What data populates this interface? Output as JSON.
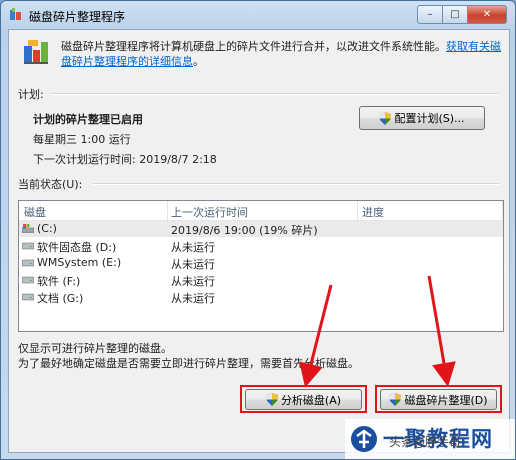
{
  "window": {
    "title": "磁盘碎片整理程序",
    "minimize_glyph": "–",
    "maximize_glyph": "□",
    "close_glyph": "✕"
  },
  "intro": {
    "text": "磁盘碎片整理程序将计算机硬盘上的碎片文件进行合并，以改进文件系统性能。",
    "link_text": "获取有关磁盘碎片整理程序的详细信息",
    "end": "。"
  },
  "schedule": {
    "section_label": "计划:",
    "status": "计划的碎片整理已启用",
    "frequency": "每星期三  1:00 运行",
    "next_run": "下一次计划运行时间: 2019/8/7 2:18",
    "configure_button": "配置计划(S)..."
  },
  "current_status": {
    "section_label": "当前状态(U):",
    "columns": [
      "磁盘",
      "上一次运行时间",
      "进度"
    ],
    "rows": [
      {
        "disk": "(C:)",
        "last_run": "2019/8/6 19:00 (19% 碎片)",
        "progress": "",
        "icon": "windows-drive-icon",
        "selected": true
      },
      {
        "disk": "软件固态盘 (D:)",
        "last_run": "从未运行",
        "progress": "",
        "icon": "drive-icon",
        "selected": false
      },
      {
        "disk": "WMSystem (E:)",
        "last_run": "从未运行",
        "progress": "",
        "icon": "drive-icon",
        "selected": false
      },
      {
        "disk": "软件 (F:)",
        "last_run": "从未运行",
        "progress": "",
        "icon": "drive-icon",
        "selected": false
      },
      {
        "disk": "文档 (G:)",
        "last_run": "从未运行",
        "progress": "",
        "icon": "drive-icon",
        "selected": false
      }
    ]
  },
  "notes": {
    "line1": "仅显示可进行碎片整理的磁盘。",
    "line2": "为了最好地确定磁盘是否需要立即进行碎片整理，需要首先分析磁盘。"
  },
  "actions": {
    "analyze_button": "分析磁盘(A)",
    "defrag_button": "磁盘碎片整理(D)"
  },
  "watermark": {
    "brand": "一聚教程网",
    "overlay": "头条@胖手哥"
  },
  "colors": {
    "highlight_red": "#e0141a",
    "link_blue": "#0066cc"
  }
}
